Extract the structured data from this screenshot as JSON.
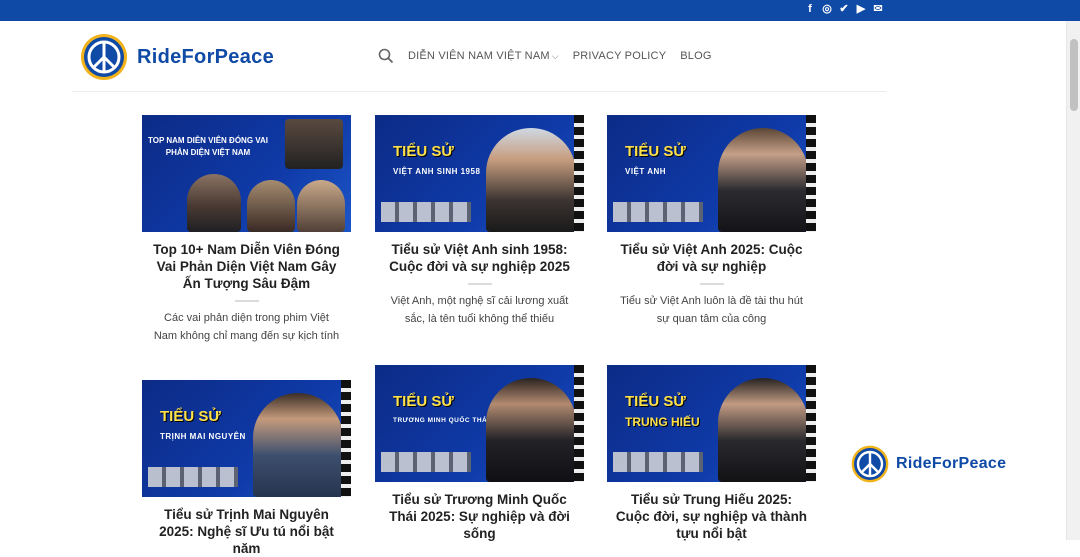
{
  "topbar": {
    "social": [
      {
        "name": "facebook-icon",
        "glyph": "f"
      },
      {
        "name": "instagram-icon",
        "glyph": "◎"
      },
      {
        "name": "twitter-icon",
        "glyph": "✔"
      },
      {
        "name": "youtube-icon",
        "glyph": "▶"
      },
      {
        "name": "email-icon",
        "glyph": "✉"
      }
    ]
  },
  "brand": {
    "name": "RideForPeace",
    "color": "#0f4aa6",
    "accent": "#f2b21a"
  },
  "nav": {
    "items": [
      "DIỄN VIÊN NAM VIỆT NAM",
      "PRIVACY POLICY",
      "BLOG"
    ]
  },
  "posts": [
    {
      "title": "Top 10+ Nam Diễn Viên Đóng Vai Phản Diện Việt Nam Gây Ấn Tượng Sâu Đậm",
      "excerpt": "Các vai phản diện trong phim Việt Nam không chỉ mang đến sự kịch tính",
      "thumb_top": "TOP NAM DIỄN VIÊN ĐÓNG VAI PHẢN DIỆN VIỆT NAM",
      "thumb_main": "",
      "thumb_sub": ""
    },
    {
      "title": "Tiểu sử Việt Anh sinh 1958: Cuộc đời và sự nghiệp 2025",
      "excerpt": "Việt Anh, một nghệ sĩ cải lương xuất sắc, là tên tuổi không thể thiếu",
      "thumb_top": "",
      "thumb_main": "TIỂU SỬ",
      "thumb_sub": "VIỆT ANH SINH 1958"
    },
    {
      "title": "Tiểu sử Việt Anh 2025: Cuộc đời và sự nghiệp",
      "excerpt": "Tiểu sử Việt Anh luôn là đề tài thu hút sự quan tâm của công",
      "thumb_top": "",
      "thumb_main": "TIỂU SỬ",
      "thumb_sub": "VIỆT ANH"
    },
    {
      "title": "Tiểu sử Trịnh Mai Nguyên 2025: Nghệ sĩ Ưu tú nổi bật năm",
      "excerpt": "",
      "thumb_top": "",
      "thumb_main": "TIỂU SỬ",
      "thumb_sub": "TRỊNH MAI NGUYÊN"
    },
    {
      "title": "Tiểu sử Trương Minh Quốc Thái 2025: Sự nghiệp và đời sống",
      "excerpt": "",
      "thumb_top": "",
      "thumb_main": "TIỂU SỬ",
      "thumb_sub": "TRƯƠNG MINH QUỐC THÁI"
    },
    {
      "title": "Tiểu sử Trung Hiếu 2025: Cuộc đời, sự nghiệp và thành tựu nổi bật",
      "excerpt": "",
      "thumb_top": "",
      "thumb_main": "TIỂU SỬ",
      "thumb_sub": "TRUNG HIẾU"
    }
  ]
}
